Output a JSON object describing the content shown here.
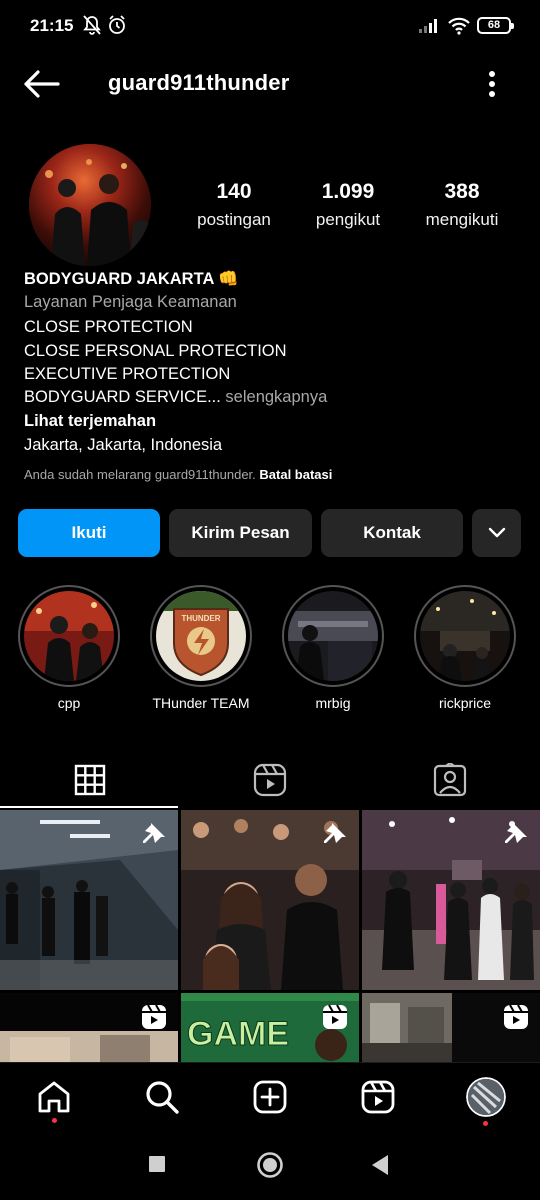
{
  "status_bar": {
    "time": "21:15",
    "battery": "68"
  },
  "header": {
    "username": "guard911thunder",
    "back_icon": "arrow-left-icon",
    "more_icon": "vertical-dots-icon"
  },
  "stats": [
    {
      "value": "140",
      "label": "postingan"
    },
    {
      "value": "1.099",
      "label": "pengikut"
    },
    {
      "value": "388",
      "label": "mengikuti"
    }
  ],
  "bio": {
    "name": "BODYGUARD JAKARTA 👊",
    "category": "Layanan Penjaga Keamanan",
    "lines": [
      "CLOSE PROTECTION",
      "CLOSE PERSONAL PROTECTION",
      "EXECUTIVE PROTECTION",
      "BODYGUARD SERVICE..."
    ],
    "more": "selengkapnya",
    "translate": "Lihat terjemahan",
    "location": "Jakarta, Jakarta, Indonesia",
    "restrict_notice": "Anda sudah melarang guard911thunder.",
    "restrict_action": "Batal batasi"
  },
  "actions": {
    "follow": "Ikuti",
    "message": "Kirim Pesan",
    "contact": "Kontak"
  },
  "highlights": [
    {
      "label": "cpp"
    },
    {
      "label": "THunder TEAM"
    },
    {
      "label": "mrbig"
    },
    {
      "label": "rickprice"
    }
  ],
  "highlight_badge_text": "THUNDER",
  "grid_cell_text": {
    "game_day": "GAME"
  },
  "colors": {
    "accent": "#0095f6",
    "button": "#262626",
    "background": "#000000",
    "notification_dot": "#ff3040"
  }
}
